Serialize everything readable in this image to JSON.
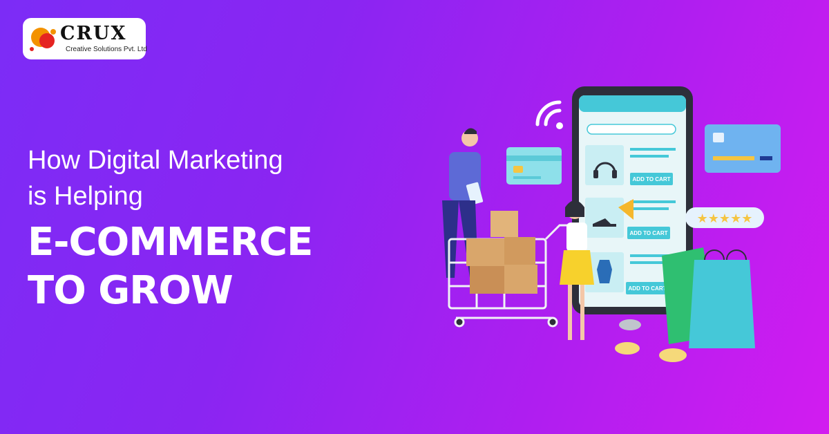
{
  "brand": {
    "name": "CRUX",
    "tagline": "Creative Solutions Pvt. Ltd"
  },
  "headline": {
    "line1": "How Digital Marketing",
    "line2": "is Helping",
    "line3": "E-COMMERCE",
    "line4": "TO GROW"
  },
  "phone": {
    "add_to_cart": [
      "ADD TO CART",
      "ADD TO CART",
      "ADD TO CART"
    ],
    "rating_stars": 5
  },
  "colors": {
    "background_start": "#7c2cf6",
    "background_end": "#d21cf0",
    "accent_teal": "#45c8d8",
    "logo_red": "#e52421",
    "logo_orange": "#f39200"
  }
}
